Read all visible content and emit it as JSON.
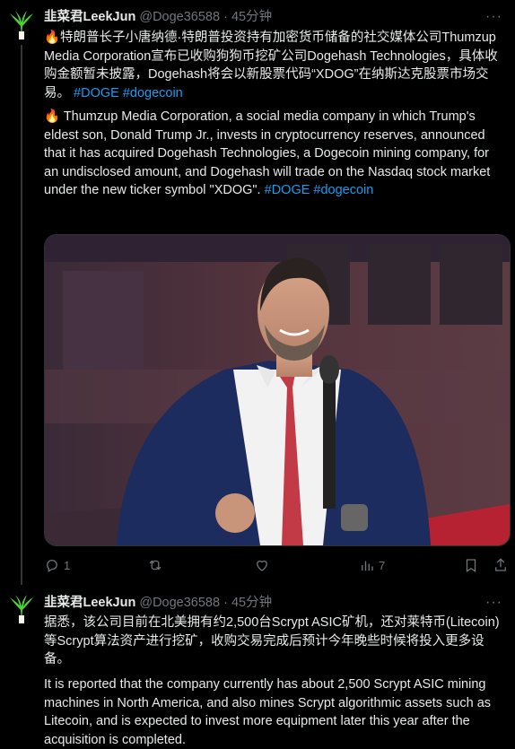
{
  "tweets": [
    {
      "author_name": "韭菜君LeekJun",
      "handle": "@Doge36588",
      "separator": "·",
      "time": "45分钟",
      "more_label": "···",
      "text_zh": "🔥特朗普长子小唐纳德·特朗普投资持有加密货币储备的社交媒体公司Thumzup Media Corporation宣布已收购狗狗币挖矿公司Dogehash Technologies，具体收购金额暂未披露，Dogehash将会以新股票代码“XDOG”在纳斯达克股票市场交易。",
      "hashtags_zh": "#DOGE #dogecoin",
      "text_en": "🔥 Thumzup Media Corporation, a social media company in which Trump's eldest son, Donald Trump Jr., invests in cryptocurrency reserves, announced that it has acquired Dogehash Technologies, a Dogecoin mining company, for an undisclosed amount, and Dogehash will trade on the Nasdaq stock market under the new ticker symbol \"XDOG\".",
      "hashtag_en_1": "#DOGE",
      "hashtag_en_2": "#dogecoin",
      "actions": {
        "reply_count": "1",
        "retweet_count": "",
        "like_count": "",
        "views_count": "7"
      }
    },
    {
      "author_name": "韭菜君LeekJun",
      "handle": "@Doge36588",
      "separator": "·",
      "time": "45分钟",
      "more_label": "···",
      "text_zh": "据悉，该公司目前在北美拥有约2,500台Scrypt ASIC矿机，还对莱特币(Litecoin)等Scrypt算法资产进行挖矿，收购交易完成后预计今年晚些时候将投入更多设备。",
      "text_en": "It is reported that the company currently has about 2,500 Scrypt ASIC mining machines in North America, and also mines Scrypt algorithmic assets such as Litecoin, and is expected to invest more equipment later this year after the acquisition is completed."
    }
  ],
  "colors": {
    "background": "#000000",
    "text": "#e7e9ea",
    "secondary": "#71767b",
    "link": "#1d9bf0",
    "avatar_green": "#4cd137",
    "thread_line": "#333639"
  },
  "icons": [
    "reply-icon",
    "retweet-icon",
    "like-icon",
    "views-icon",
    "bookmark-icon",
    "share-icon",
    "more-icon",
    "avatar-leek-icon"
  ]
}
